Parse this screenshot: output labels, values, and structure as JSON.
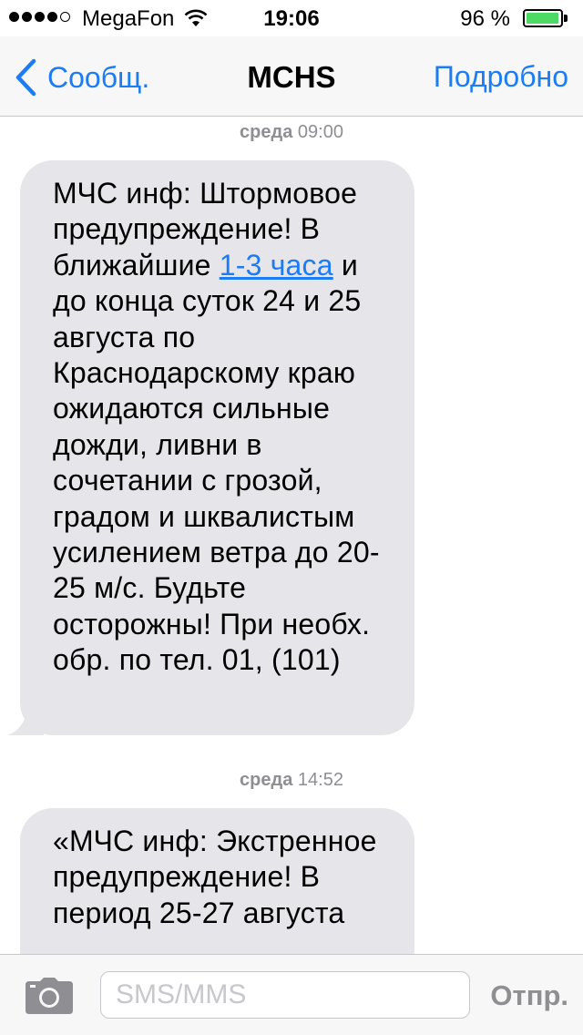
{
  "status_bar": {
    "carrier": "MegaFon",
    "time": "19:06",
    "battery_percent_label": "96 %",
    "battery_level": 0.96,
    "battery_color": "#4cd964"
  },
  "nav": {
    "back_label": "Сообщ.",
    "title": "MCHS",
    "details_label": "Подробно",
    "accent_color": "#1c7cf4"
  },
  "messages": [
    {
      "timestamp_day": "среда",
      "timestamp_time": "09:00",
      "text_before_link": "МЧС инф: Штормовое предупреждение! В ближайшие ",
      "link_text": "1-3 часа",
      "text_after_link": " и до конца суток 24 и 25 августа по Краснодарскому краю ожидаются сильные дожди, ливни в сочетании с грозой, градом и шквалистым усилением ветра до 20-25 м/с. Будьте осторожны! При необх.  обр. по тел. 01, (101)"
    },
    {
      "timestamp_day": "среда",
      "timestamp_time": "14:52",
      "text": "«МЧС инф: Экстренное предупреждение! В период 25-27 августа"
    }
  ],
  "input_bar": {
    "placeholder": "SMS/MMS",
    "send_label": "Отпр.",
    "camera_icon": "camera-icon"
  }
}
